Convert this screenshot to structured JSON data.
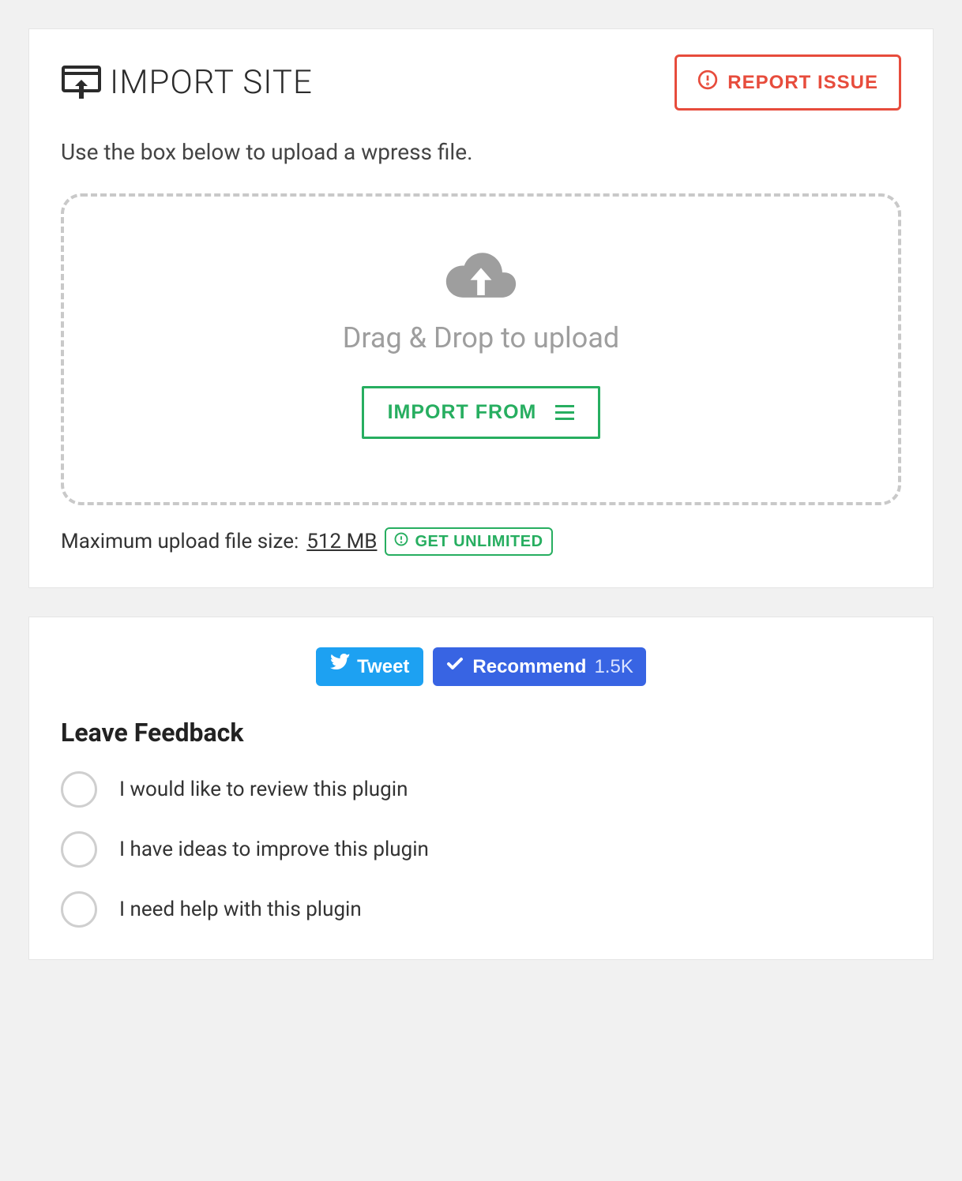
{
  "header": {
    "title": "IMPORT SITE",
    "report_label": "REPORT ISSUE"
  },
  "subtitle": "Use the box below to upload a wpress file.",
  "dropzone": {
    "text": "Drag & Drop to upload",
    "import_button": "IMPORT FROM"
  },
  "limit": {
    "label": "Maximum upload file size:",
    "value": "512 MB",
    "unlimited_label": "GET UNLIMITED"
  },
  "social": {
    "tweet": "Tweet",
    "recommend": "Recommend",
    "recommend_count": "1.5K"
  },
  "feedback": {
    "title": "Leave Feedback",
    "options": [
      "I would like to review this plugin",
      "I have ideas to improve this plugin",
      "I need help with this plugin"
    ]
  }
}
